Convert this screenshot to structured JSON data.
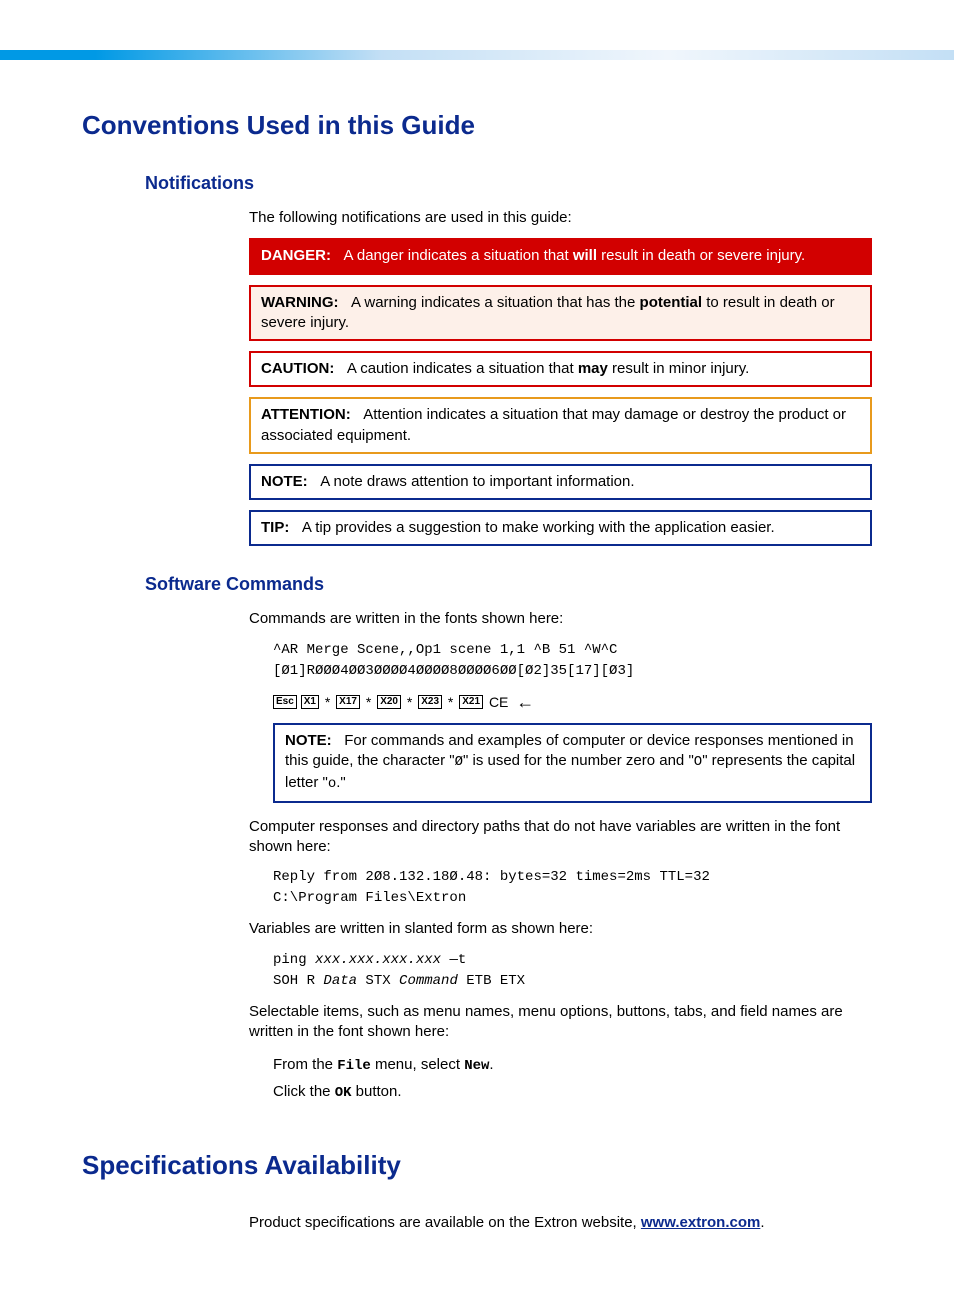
{
  "h1_conventions": "Conventions Used in this Guide",
  "h2_notifications": "Notifications",
  "notif_intro": "The following notifications are used in this guide:",
  "danger": {
    "label": "DANGER:",
    "pre": "A danger indicates a situation that ",
    "bold": "will",
    "post": " result in death or severe injury."
  },
  "warning": {
    "label": "WARNING:",
    "pre": "A warning indicates a situation that has the ",
    "bold": "potential",
    "post": " to result in death or severe injury."
  },
  "caution": {
    "label": "CAUTION:",
    "pre": "A caution indicates a situation that ",
    "bold": "may",
    "post": " result in minor injury."
  },
  "attention": {
    "label": "ATTENTION:",
    "text": "Attention indicates a situation that may damage or destroy the product or associated equipment."
  },
  "note": {
    "label": "NOTE:",
    "text": "A note draws attention to important information."
  },
  "tip": {
    "label": "TIP:",
    "text": "A tip provides a suggestion to make working with the application easier."
  },
  "h2_software": "Software Commands",
  "sw_intro": "Commands are written in the fonts shown here:",
  "sw_cmd_line1": "^AR Merge Scene,,Op1 scene 1,1 ^B 51 ^W^C",
  "sw_cmd_line2": "[Ø1]RØØØ4ØØ3ØØØØ4ØØØØ8ØØØØ6ØØ[Ø2]35[17][Ø3]",
  "keys": {
    "esc": "Esc",
    "x1": "X1",
    "x17": "X17",
    "x20": "X20",
    "x23": "X23",
    "x21": "X21",
    "ce": "CE",
    "arrow": "←"
  },
  "sw_note": {
    "label": "NOTE:",
    "part1": "For commands and examples of computer or device responses mentioned in this guide, the character \"",
    "zero": "Ø",
    "part2": "\" is used for the number zero and \"",
    "oh": "O",
    "part3": "\" represents the capital letter \"",
    "o2": "o",
    "part4": ".\""
  },
  "resp_intro": "Computer responses and directory paths that do not have variables are written in the font shown here:",
  "resp_line1": "Reply from 2Ø8.132.18Ø.48: bytes=32 times=2ms TTL=32",
  "resp_line2": "C:\\Program Files\\Extron",
  "var_intro": "Variables are written in slanted form as shown here:",
  "var_line1_a": "ping ",
  "var_line1_b": "xxx.xxx.xxx.xxx",
  "var_line1_c": " —t",
  "var_line2_a": "SOH R ",
  "var_line2_b": "Data",
  "var_line2_c": " STX ",
  "var_line2_d": "Command",
  "var_line2_e": " ETB ETX",
  "sel_intro": "Selectable items, such as menu names, menu options, buttons, tabs, and field names are written in the font shown here:",
  "sel_line1_a": "From the ",
  "sel_line1_b": "File",
  "sel_line1_c": " menu, select ",
  "sel_line1_d": "New",
  "sel_line1_e": ".",
  "sel_line2_a": "Click the ",
  "sel_line2_b": "OK",
  "sel_line2_c": " button.",
  "h1_spec": "Specifications Availability",
  "spec_text_a": "Product specifications are available on the Extron website, ",
  "spec_link": "www.extron.com",
  "spec_text_b": "."
}
